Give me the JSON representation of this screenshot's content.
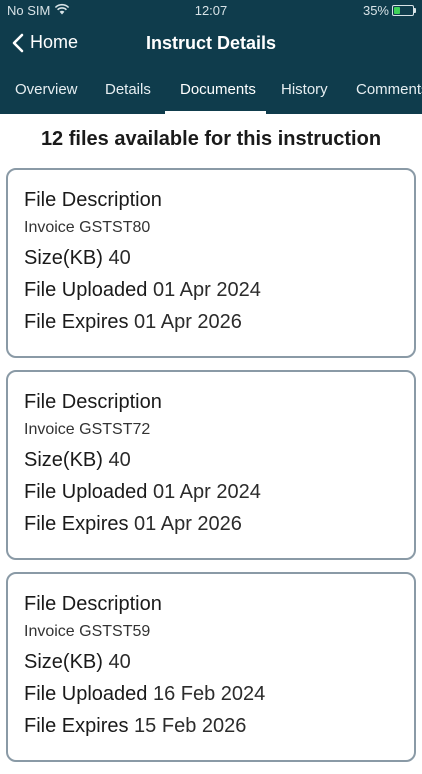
{
  "status_bar": {
    "carrier": "No SIM",
    "time": "12:07",
    "battery": "35%",
    "battery_level": 0.35
  },
  "nav": {
    "back_label": "Home",
    "title": "Instruct Details"
  },
  "tabs": [
    {
      "label": "Overview"
    },
    {
      "label": "Details"
    },
    {
      "label": "Documents",
      "active": true
    },
    {
      "label": "History"
    },
    {
      "label": "Comments"
    }
  ],
  "heading": "12 files available for this instruction",
  "labels": {
    "description": "File Description",
    "size": "Size(KB)",
    "uploaded": "File Uploaded",
    "expires": "File Expires"
  },
  "files": [
    {
      "description": "Invoice GSTST80",
      "size": "40",
      "uploaded": "01 Apr 2024",
      "expires": "01 Apr 2026"
    },
    {
      "description": "Invoice GSTST72",
      "size": "40",
      "uploaded": "01 Apr 2024",
      "expires": "01 Apr 2026"
    },
    {
      "description": "Invoice GSTST59",
      "size": "40",
      "uploaded": "16 Feb 2024",
      "expires": "15 Feb 2026"
    }
  ],
  "colors": {
    "header_bg": "#0f3c4c",
    "card_border": "#8a9aa6"
  }
}
